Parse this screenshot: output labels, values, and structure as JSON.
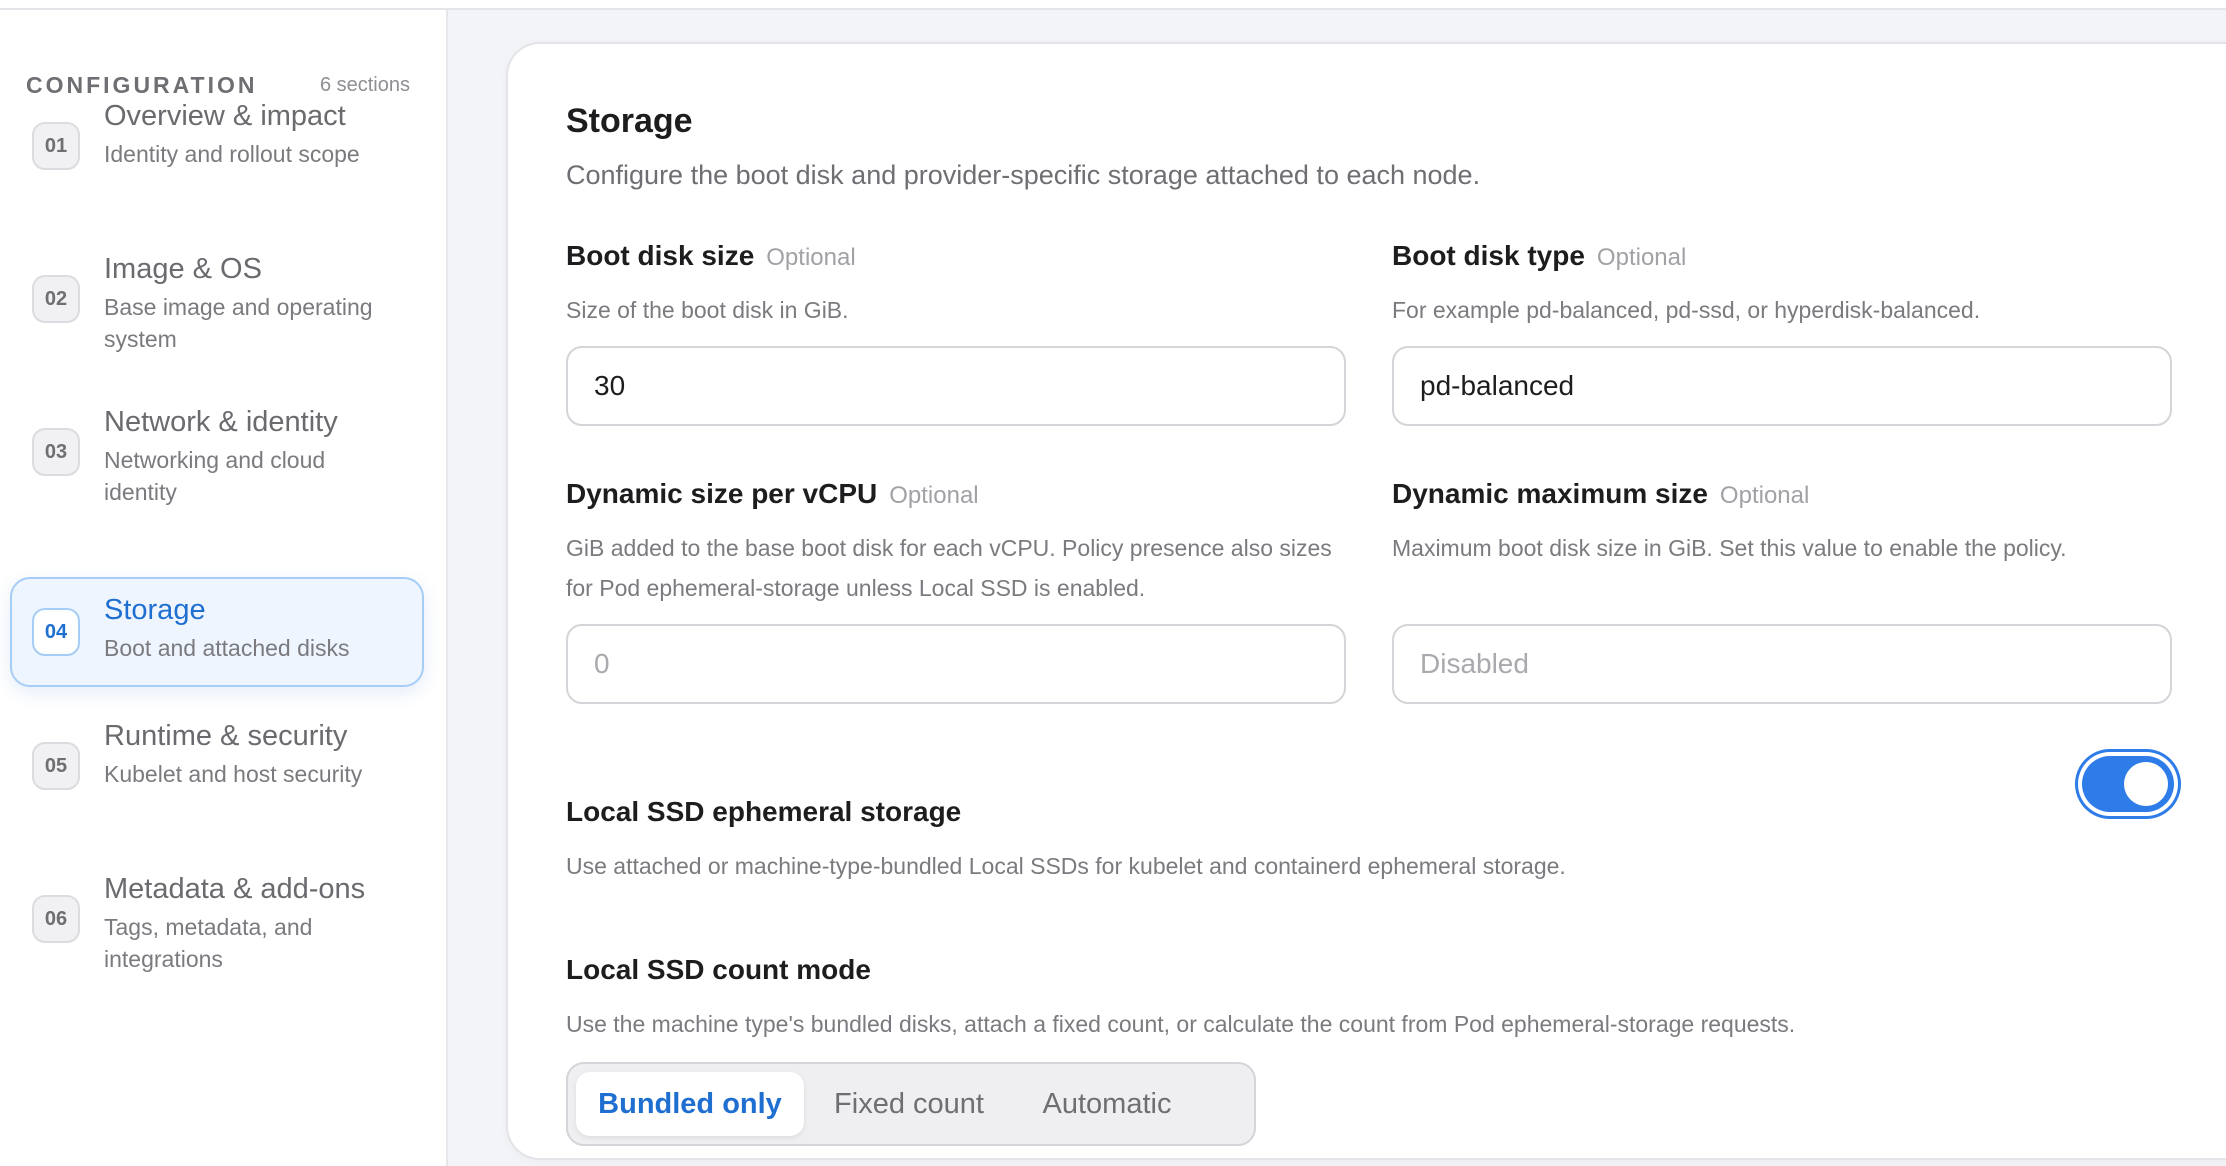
{
  "sidebar": {
    "title": "CONFIGURATION",
    "count": "6 sections",
    "items": [
      {
        "num": "01",
        "label": "Overview & impact",
        "desc": "Identity and rollout scope"
      },
      {
        "num": "02",
        "label": "Image & OS",
        "desc": "Base image and operating system"
      },
      {
        "num": "03",
        "label": "Network & identity",
        "desc": "Networking and cloud identity"
      },
      {
        "num": "04",
        "label": "Storage",
        "desc": "Boot and attached disks",
        "active": true
      },
      {
        "num": "05",
        "label": "Runtime & security",
        "desc": "Kubelet and host security"
      },
      {
        "num": "06",
        "label": "Metadata & add-ons",
        "desc": "Tags, metadata, and integrations"
      }
    ]
  },
  "storage": {
    "title": "Storage",
    "description": "Configure the boot disk and provider-specific storage attached to each node.",
    "optional_label": "Optional",
    "boot_disk_size": {
      "label": "Boot disk size",
      "help": "Size of the boot disk in GiB.",
      "value": "30"
    },
    "boot_disk_type": {
      "label": "Boot disk type",
      "help": "For example pd-balanced, pd-ssd, or hyperdisk-balanced.",
      "value": "pd-balanced"
    },
    "dynamic_size_per_vcpu": {
      "label": "Dynamic size per vCPU",
      "help": "GiB added to the base boot disk for each vCPU. Policy presence also sizes for Pod ephemeral-storage unless Local SSD is enabled.",
      "placeholder": "0"
    },
    "dynamic_max_size": {
      "label": "Dynamic maximum size",
      "help": "Maximum boot disk size in GiB. Set this value to enable the policy.",
      "placeholder": "Disabled"
    },
    "local_ssd": {
      "label": "Local SSD ephemeral storage",
      "help": "Use attached or machine-type-bundled Local SSDs for kubelet and containerd ephemeral storage.",
      "enabled": true
    },
    "local_ssd_count_mode": {
      "label": "Local SSD count mode",
      "help": "Use the machine type's bundled disks, attach a fixed count, or calculate the count from Pod ephemeral-storage requests.",
      "options": [
        "Bundled only",
        "Fixed count",
        "Automatic"
      ],
      "selected": "Bundled only"
    }
  },
  "colors": {
    "accent": "#1f6fd1",
    "toggle_on": "#2d7ce8",
    "active_nav_bg": "#eef5fe"
  }
}
